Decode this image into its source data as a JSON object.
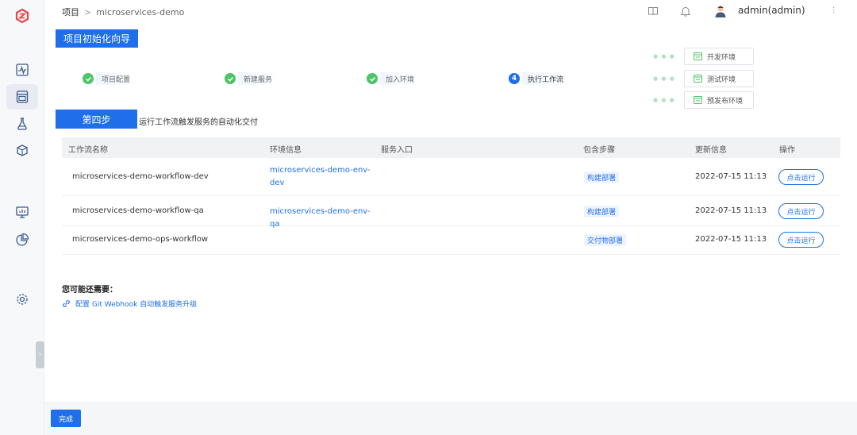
{
  "breadcrumb": {
    "root": "项目",
    "separator": ">",
    "current": "microservices-demo"
  },
  "user": {
    "name": "admin(admin)"
  },
  "wizard": {
    "title": "项目初始化向导",
    "steps": [
      {
        "label": "项目配置",
        "state": "done"
      },
      {
        "label": "新建服务",
        "state": "done"
      },
      {
        "label": "加入环境",
        "state": "done"
      },
      {
        "label": "执行工作流",
        "state": "current",
        "number": "4"
      }
    ],
    "environments": [
      "开发环境",
      "测试环境",
      "预发布环境"
    ]
  },
  "current_step": {
    "badge": "第四步",
    "description": "运行工作流触发服务的自动化交付"
  },
  "table": {
    "headers": [
      "工作流名称",
      "环境信息",
      "服务入口",
      "包含步骤",
      "更新信息",
      "操作"
    ],
    "rows": [
      {
        "name": "microservices-demo-workflow-dev",
        "env": "microservices-demo-env-dev",
        "entry": "",
        "steps": "构建部署",
        "updated": "2022-07-15 11:13",
        "action": "点击运行"
      },
      {
        "name": "microservices-demo-workflow-qa",
        "env": "microservices-demo-env-qa",
        "entry": "",
        "steps": "构建部署",
        "updated": "2022-07-15 11:13",
        "action": "点击运行"
      },
      {
        "name": "microservices-demo-ops-workflow",
        "env": "",
        "entry": "",
        "steps": "交付物部署",
        "updated": "2022-07-15 11:13",
        "action": "点击运行"
      }
    ]
  },
  "more": {
    "title": "您可能还需要：",
    "link": "配置 Git Webhook 自动触发服务升级"
  },
  "footer": {
    "done_label": "完成"
  },
  "colors": {
    "accent": "#1f6feb",
    "success": "#4ec468",
    "logo": "#e5484d"
  },
  "icons": {
    "sidebar": [
      "logo-icon",
      "activity-icon",
      "project-icon",
      "test-icon",
      "artifact-icon",
      "monitor-icon",
      "pie-chart-icon",
      "settings-icon"
    ],
    "topbar": [
      "book-icon",
      "bell-icon",
      "avatar"
    ]
  }
}
